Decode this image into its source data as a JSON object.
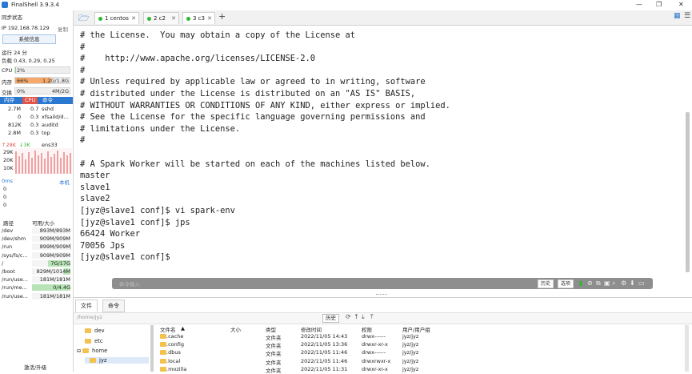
{
  "window": {
    "title": "FinalShell 3.9.3.4",
    "min_icon": "minimize-icon",
    "max_icon": "maximize-icon",
    "close_icon": "close-icon"
  },
  "left": {
    "sync_status": "同步状态",
    "ip_label": "IP 192.168.78.129",
    "copy": "复制",
    "sysinfo_button": "系统信息",
    "uptime": "运行 24 分",
    "load": "负载 0.43, 0.29, 0.25",
    "cpu": {
      "label": "CPU",
      "value": "2%",
      "fraction": 0.02
    },
    "mem": {
      "label": "内存",
      "percent": "66%",
      "value": "1.2G/1.8G",
      "fraction": 0.66
    },
    "swap": {
      "label": "交换",
      "percent": "0%",
      "value": "4M/2G",
      "fraction": 0.0
    },
    "proc_tabs": [
      "内存",
      "CPU",
      "命令"
    ],
    "processes": [
      {
        "mem": "2.7M",
        "cpu": "0.7",
        "cmd": "sshd"
      },
      {
        "mem": "0",
        "cpu": "0.3",
        "cmd": "xfsaild/d..."
      },
      {
        "mem": "812K",
        "cpu": "0.3",
        "cmd": "auditd"
      },
      {
        "mem": "2.8M",
        "cpu": "0.3",
        "cmd": "top"
      }
    ],
    "net": {
      "up": "↑28K",
      "down": "↓3K",
      "iface": "ens33",
      "ticks": [
        "29K",
        "20K",
        "10K"
      ]
    },
    "latency": {
      "label": "0ms",
      "target": "本机",
      "values": [
        "0",
        "0",
        "0"
      ]
    },
    "disk_headers": [
      "路径",
      "可用/大小"
    ],
    "disks": [
      {
        "path": "/dev",
        "size": "893M/893M",
        "used": 0.0
      },
      {
        "path": "/dev/shm",
        "size": "909M/909M",
        "used": 0.0
      },
      {
        "path": "/run",
        "size": "899M/909M",
        "used": 0.01
      },
      {
        "path": "/sys/fs/c...",
        "size": "909M/909M",
        "used": 0.0
      },
      {
        "path": "/",
        "size": "7G/17G",
        "used": 0.59
      },
      {
        "path": "/boot",
        "size": "829M/1014M",
        "used": 0.18
      },
      {
        "path": "/run/use...",
        "size": "181M/181M",
        "used": 0.0
      },
      {
        "path": "/run/me...",
        "size": "0/4.4G",
        "used": 1.0
      },
      {
        "path": "/run/use...",
        "size": "181M/181M",
        "used": 0.0
      }
    ],
    "activate": "激活/升级"
  },
  "tabs": {
    "folder_icon": "folder-open-icon",
    "items": [
      {
        "label": "1 centos"
      },
      {
        "label": "2 c2"
      },
      {
        "label": "3 c3"
      }
    ],
    "add": "+",
    "grid_icon": "grid-icon",
    "menu_icon": "menu-icon"
  },
  "terminal": {
    "lines": [
      "# the License.  You may obtain a copy of the License at",
      "#",
      "#    http://www.apache.org/licenses/LICENSE-2.0",
      "#",
      "# Unless required by applicable law or agreed to in writing, software",
      "# distributed under the License is distributed on an \"AS IS\" BASIS,",
      "# WITHOUT WARRANTIES OR CONDITIONS OF ANY KIND, either express or implied.",
      "# See the License for the specific language governing permissions and",
      "# limitations under the License.",
      "#",
      "",
      "# A Spark Worker will be started on each of the machines listed below.",
      "master",
      "slave1",
      "slave2",
      "[jyz@slave1 conf]$ vi spark-env",
      "[jyz@slave1 conf]$ jps",
      "66424 Worker",
      "70056 Jps",
      "[jyz@slave1 conf]$"
    ]
  },
  "cmdbar": {
    "placeholder": "命令输入",
    "history": "历史",
    "options": "选项"
  },
  "bottom": {
    "tabs": [
      "文件",
      "命令"
    ],
    "path": "/home/jyz",
    "history": "历史",
    "tree": [
      "dev",
      "etc",
      "home",
      "jyz"
    ],
    "columns": [
      "文件名",
      "大小",
      "类型",
      "修改时间",
      "权限",
      "用户/用户组"
    ],
    "files": [
      {
        "name": ".cache",
        "size": "",
        "type": "文件夹",
        "mtime": "2022/11/05 14:43",
        "perm": "drwx------",
        "owner": "jyz/jyz"
      },
      {
        "name": ".config",
        "size": "",
        "type": "文件夹",
        "mtime": "2022/11/05 13:36",
        "perm": "drwxr-xr-x",
        "owner": "jyz/jyz"
      },
      {
        "name": ".dbus",
        "size": "",
        "type": "文件夹",
        "mtime": "2022/11/05 11:46",
        "perm": "drwx------",
        "owner": "jyz/jyz"
      },
      {
        "name": ".local",
        "size": "",
        "type": "文件夹",
        "mtime": "2022/11/05 11:46",
        "perm": "drwxrwxr-x",
        "owner": "jyz/jyz"
      },
      {
        "name": ".mozilla",
        "size": "",
        "type": "文件夹",
        "mtime": "2022/11/05 11:31",
        "perm": "drwxr-xr-x",
        "owner": "jyz/jyz"
      }
    ]
  },
  "colors": {
    "accent": "#2b78d0",
    "mem_fill": "#f6a96a",
    "tab_dot": "#2eb82e",
    "cpu_tab": "#e2554b"
  }
}
